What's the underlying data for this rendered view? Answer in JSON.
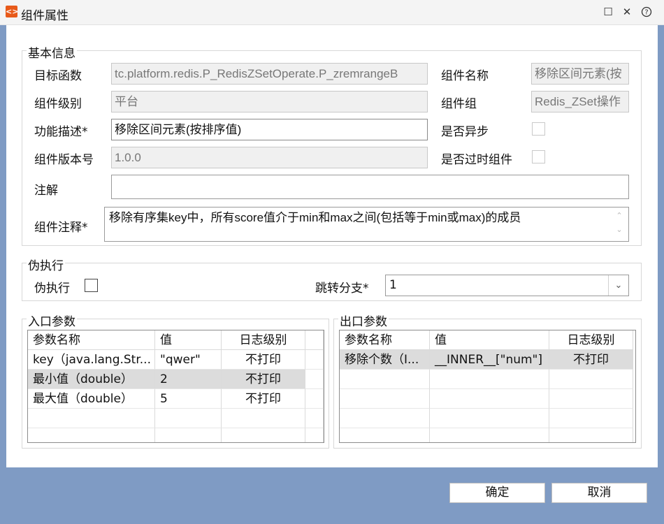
{
  "window": {
    "title": "组件属性",
    "controls": [
      "maximize",
      "close",
      "help"
    ]
  },
  "basic_info": {
    "legend": "基本信息",
    "target_function_label": "目标函数",
    "target_function_value": "tc.platform.redis.P_RedisZSetOperate.P_zremrangeB",
    "component_name_label": "组件名称",
    "component_name_value": "移除区间元素(按",
    "component_level_label": "组件级别",
    "component_level_value": "平台",
    "component_group_label": "组件组",
    "component_group_value": "Redis_ZSet操作",
    "func_desc_label": "功能描述*",
    "func_desc_value": "移除区间元素(按排序值)",
    "async_label": "是否异步",
    "version_label": "组件版本号",
    "version_value": "1.0.0",
    "deprecated_label": "是否过时组件",
    "annotation_label": "注解",
    "annotation_value": "",
    "comment_label": "组件注释*",
    "comment_value": "移除有序集key中，所有score值介于min和max之间(包括等于min或max)的成员"
  },
  "pseudo_exec": {
    "legend": "伪执行",
    "checkbox_label": "伪执行",
    "branch_label": "跳转分支*",
    "branch_value": "1"
  },
  "input_params": {
    "legend": "入口参数",
    "columns": [
      "参数名称",
      "值",
      "日志级别"
    ],
    "rows": [
      [
        "key（java.lang.Str...",
        "\"qwer\"",
        "不打印"
      ],
      [
        "最小值（double）",
        "2",
        "不打印"
      ],
      [
        "最大值（double）",
        "5",
        "不打印"
      ]
    ]
  },
  "output_params": {
    "legend": "出口参数",
    "columns": [
      "参数名称",
      "值",
      "日志级别"
    ],
    "rows": [
      [
        "移除个数（I...",
        "__INNER__[\"num\"]",
        "不打印"
      ]
    ]
  },
  "buttons": {
    "ok": "确定",
    "cancel": "取消"
  }
}
